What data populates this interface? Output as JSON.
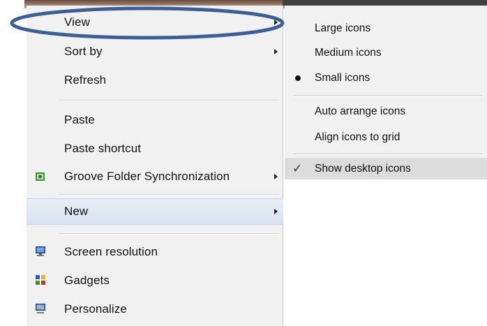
{
  "context_menu": {
    "items": [
      {
        "label": "View",
        "has_submenu": true
      },
      {
        "label": "Sort by",
        "has_submenu": true
      },
      {
        "label": "Refresh",
        "has_submenu": false
      },
      {
        "label": "Paste",
        "has_submenu": false
      },
      {
        "label": "Paste shortcut",
        "has_submenu": false
      },
      {
        "label": "Groove Folder Synchronization",
        "has_submenu": true,
        "icon": "groove-icon"
      },
      {
        "label": "New",
        "has_submenu": true
      },
      {
        "label": "Screen resolution",
        "has_submenu": false,
        "icon": "screen-resolution-icon"
      },
      {
        "label": "Gadgets",
        "has_submenu": false,
        "icon": "gadgets-icon"
      },
      {
        "label": "Personalize",
        "has_submenu": false,
        "icon": "personalize-icon"
      }
    ]
  },
  "view_submenu": {
    "items": [
      {
        "label": "Large icons",
        "state": "none"
      },
      {
        "label": "Medium icons",
        "state": "none"
      },
      {
        "label": "Small icons",
        "state": "selected-bullet"
      },
      {
        "label": "Auto arrange icons",
        "state": "none"
      },
      {
        "label": "Align icons to grid",
        "state": "none"
      },
      {
        "label": "Show desktop icons",
        "state": "checked"
      }
    ]
  },
  "annotation": {
    "color": "#3b5f95",
    "target": "View"
  }
}
